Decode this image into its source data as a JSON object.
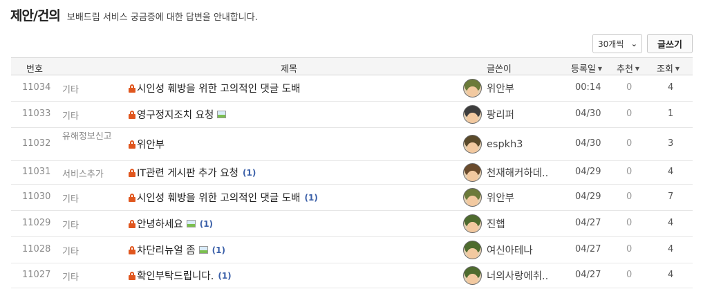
{
  "header": {
    "title": "제안/건의",
    "description": "보배드림 서비스 궁금증에 대한 답변을 안내합니다."
  },
  "controls": {
    "page_size": "30개씩",
    "write_label": "글쓰기"
  },
  "columns": {
    "num": "번호",
    "title": "제목",
    "author": "글쓴이",
    "date": "등록일",
    "recommend": "추천",
    "views": "조회"
  },
  "rows": [
    {
      "num": "11034",
      "category": "기타",
      "title": "시인성 훼방을 위한 고의적인 댓글 도배",
      "has_image": false,
      "comments": "",
      "author": "위안부",
      "date": "00:14",
      "recommend": "0",
      "views": "4",
      "avatar_color": "#6b7a3a"
    },
    {
      "num": "11033",
      "category": "기타",
      "title": "영구정지조치 요청",
      "has_image": true,
      "comments": "",
      "author": "팡리퍼",
      "date": "04/30",
      "recommend": "0",
      "views": "1",
      "avatar_color": "#3d3d3d"
    },
    {
      "num": "11032",
      "category": "유해정보신고",
      "title": "위안부",
      "has_image": false,
      "comments": "",
      "author": "espkh3",
      "date": "04/30",
      "recommend": "0",
      "views": "3",
      "avatar_color": "#5a4a2a"
    },
    {
      "num": "11031",
      "category": "서비스추가",
      "title": "IT관련 게시판 추가 요청",
      "has_image": false,
      "comments": "(1)",
      "author": "천재해커하데..",
      "date": "04/29",
      "recommend": "0",
      "views": "4",
      "avatar_color": "#6a4b2c"
    },
    {
      "num": "11030",
      "category": "기타",
      "title": "시인성 훼방을 위한 고의적인 댓글 도배",
      "has_image": false,
      "comments": "(1)",
      "author": "위안부",
      "date": "04/29",
      "recommend": "0",
      "views": "7",
      "avatar_color": "#6b7a3a"
    },
    {
      "num": "11029",
      "category": "기타",
      "title": "안녕하세요",
      "has_image": true,
      "comments": "(1)",
      "author": "진햅",
      "date": "04/27",
      "recommend": "0",
      "views": "4",
      "avatar_color": "#4e6b2e"
    },
    {
      "num": "11028",
      "category": "기타",
      "title": "차단리뉴얼 좀",
      "has_image": true,
      "comments": "(1)",
      "author": "여신아테나",
      "date": "04/27",
      "recommend": "0",
      "views": "4",
      "avatar_color": "#4e6b2e"
    },
    {
      "num": "11027",
      "category": "기타",
      "title": "확인부탁드립니다.",
      "has_image": false,
      "comments": "(1)",
      "author": "너의사랑에취..",
      "date": "04/27",
      "recommend": "0",
      "views": "4",
      "avatar_color": "#4e6b2e"
    }
  ]
}
